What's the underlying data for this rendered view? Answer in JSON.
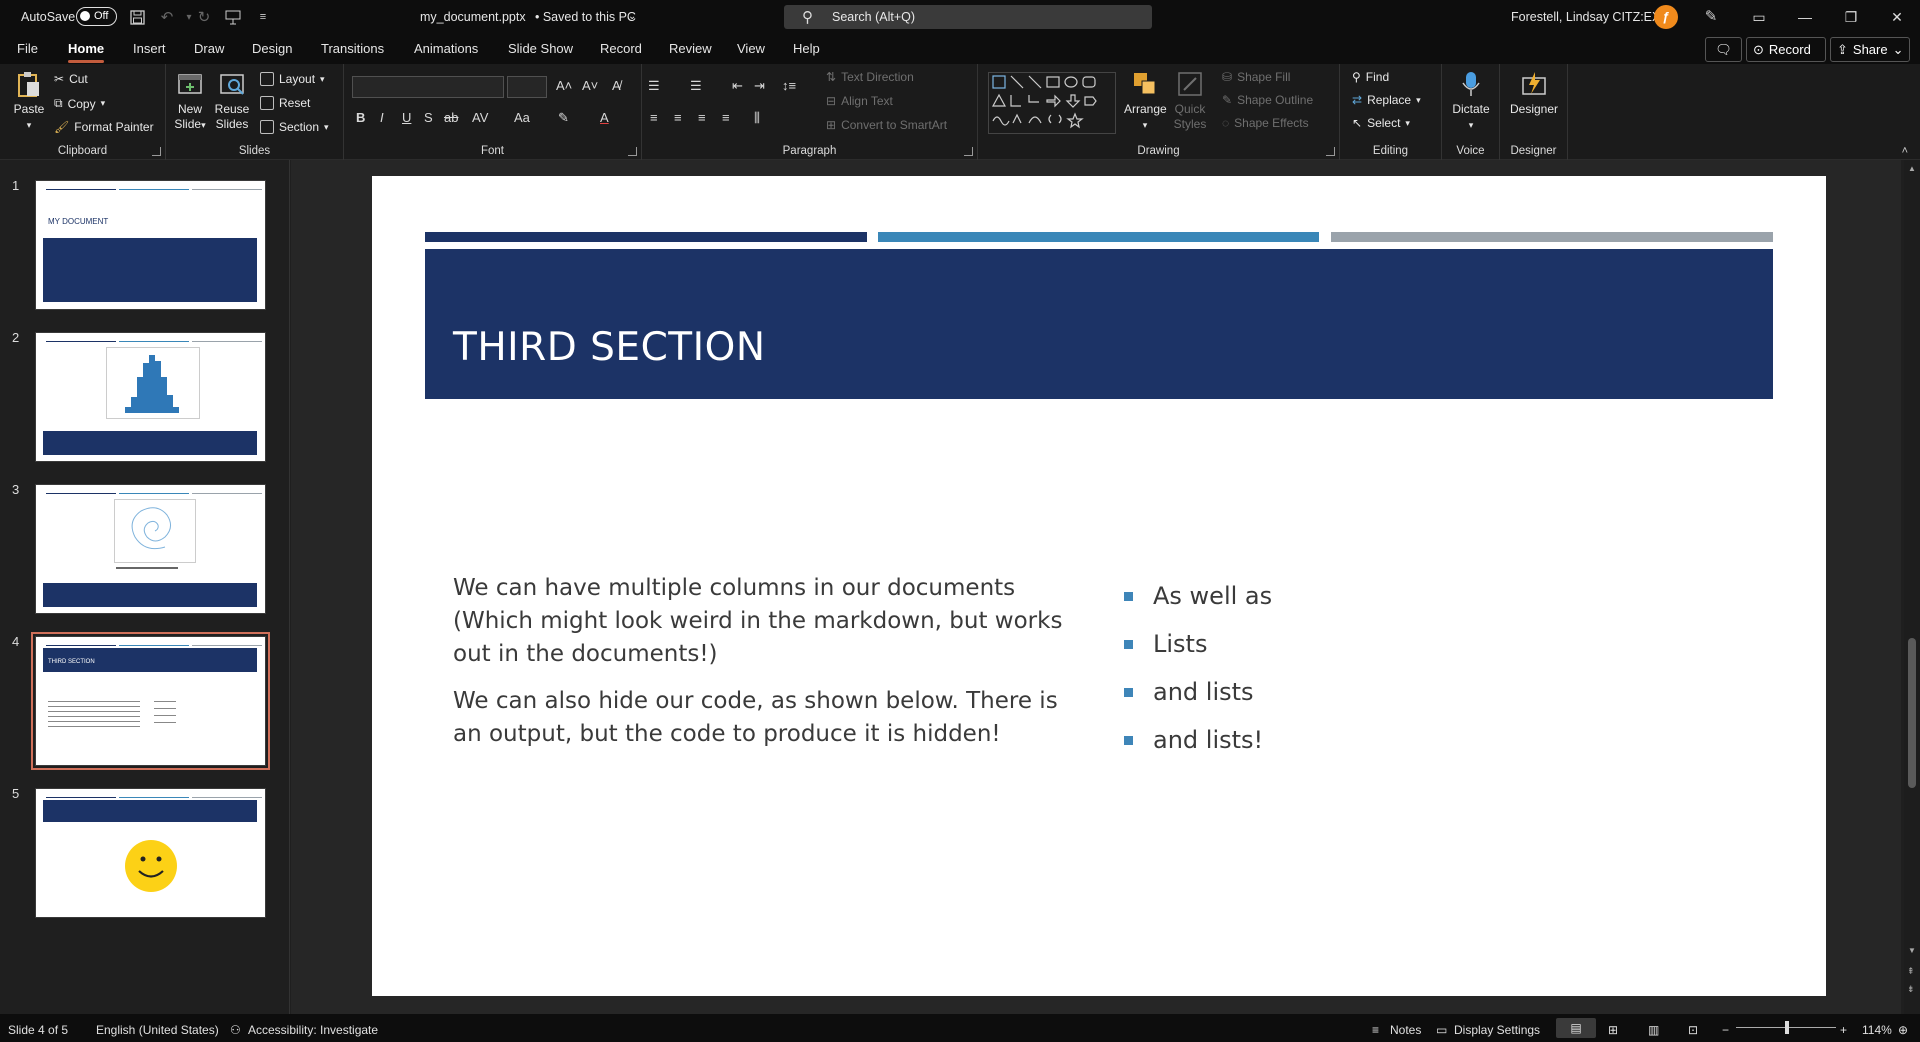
{
  "titlebar": {
    "autosave_label": "AutoSave",
    "autosave_state": "Off",
    "doc_title": "my_document.pptx",
    "save_status": "• Saved to this PC",
    "search_placeholder": "Search (Alt+Q)",
    "user_name": "Forestell, Lindsay CITZ:EX"
  },
  "menu": {
    "tabs": [
      "File",
      "Home",
      "Insert",
      "Draw",
      "Design",
      "Transitions",
      "Animations",
      "Slide Show",
      "Record",
      "Review",
      "View",
      "Help"
    ],
    "active_tab": "Home",
    "record_button": "Record",
    "share_button": "Share"
  },
  "ribbon": {
    "clipboard": {
      "paste": "Paste",
      "cut": "Cut",
      "copy": "Copy",
      "format_painter": "Format Painter",
      "label": "Clipboard"
    },
    "slides": {
      "new_slide_1": "New",
      "new_slide_2": "Slide",
      "reuse_1": "Reuse",
      "reuse_2": "Slides",
      "layout": "Layout",
      "reset": "Reset",
      "section": "Section",
      "label": "Slides"
    },
    "font": {
      "label": "Font"
    },
    "paragraph": {
      "text_direction": "Text Direction",
      "align_text": "Align Text",
      "convert_smartart": "Convert to SmartArt",
      "label": "Paragraph"
    },
    "drawing": {
      "arrange": "Arrange",
      "quick_styles_1": "Quick",
      "quick_styles_2": "Styles",
      "shape_fill": "Shape Fill",
      "shape_outline": "Shape Outline",
      "shape_effects": "Shape Effects",
      "label": "Drawing"
    },
    "editing": {
      "find": "Find",
      "replace": "Replace",
      "select": "Select",
      "label": "Editing"
    },
    "voice": {
      "dictate": "Dictate",
      "label": "Voice"
    },
    "designer": {
      "designer": "Designer",
      "label": "Designer"
    }
  },
  "thumbnails": {
    "numbers": [
      "1",
      "2",
      "3",
      "4",
      "5"
    ],
    "selected": 4,
    "t1_title": "MY DOCUMENT"
  },
  "slide": {
    "title": "THIRD SECTION",
    "left_paragraphs": [
      "We can have multiple columns in our documents (Which might look weird in the markdown, but works out in the documents!)",
      "We can also hide our code, as shown below. There is an output, but the code to produce it is hidden!"
    ],
    "bullets": [
      "As well as",
      "Lists",
      "and lists",
      "and lists!"
    ],
    "bar_colors": [
      "#1c3366",
      "#3a87b8",
      "#9aa3ab"
    ]
  },
  "statusbar": {
    "slide_pos": "Slide 4 of 5",
    "language": "English (United States)",
    "accessibility": "Accessibility: Investigate",
    "notes": "Notes",
    "display_settings": "Display Settings",
    "zoom": "114%"
  }
}
